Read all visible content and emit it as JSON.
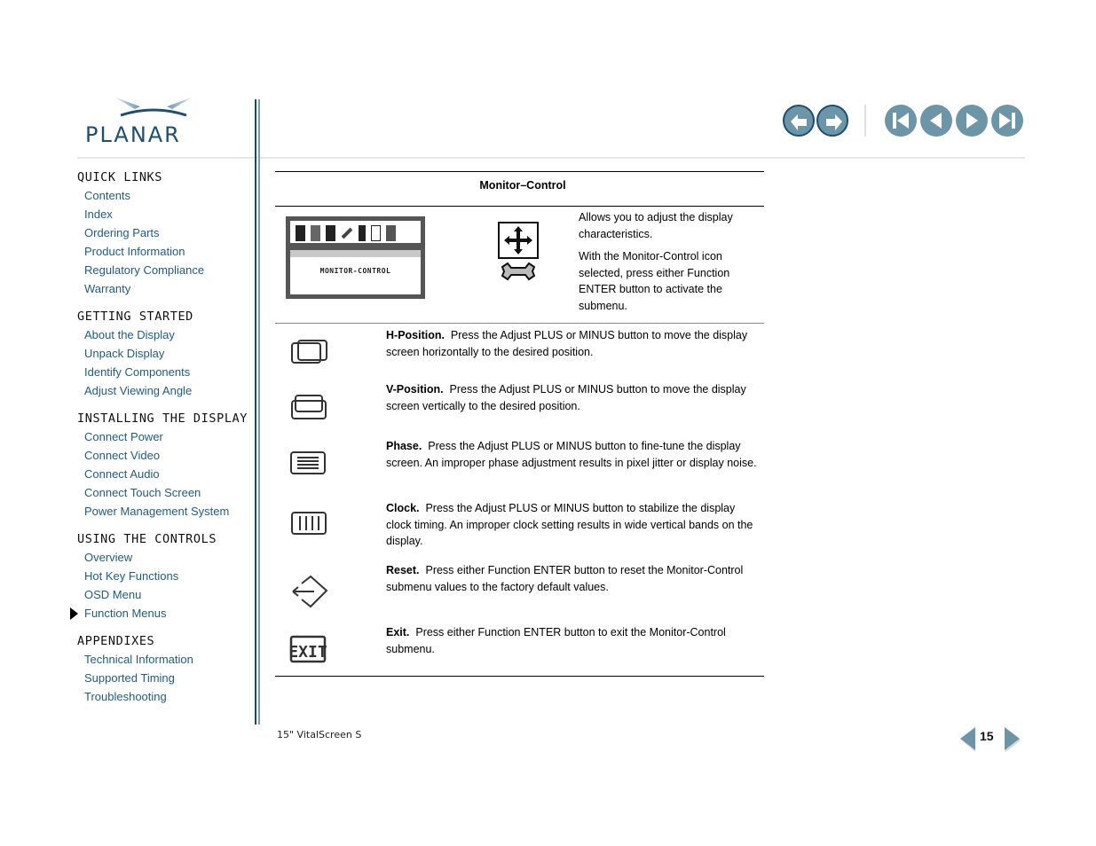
{
  "brand": {
    "name": "PLANAR",
    "color": "#1c4f72",
    "accent": "#6d95a8"
  },
  "top_nav": {
    "back_label": "back-icon",
    "forward_label": "forward-icon",
    "first_page": "first-page-icon",
    "prev_page": "previous-page-icon",
    "next_page": "next-page-icon",
    "last_page": "last-page-icon"
  },
  "sidebar": {
    "sections": [
      {
        "heading": "QUICK LINKS",
        "items": [
          "Contents",
          "Index",
          "Ordering Parts",
          "Product Information",
          "Regulatory Compliance",
          "Warranty"
        ]
      },
      {
        "heading": "GETTING STARTED",
        "items": [
          "About the Display",
          "Unpack Display",
          "Identify Components",
          "Adjust Viewing Angle"
        ]
      },
      {
        "heading": "INSTALLING THE DISPLAY",
        "items": [
          "Connect Power",
          "Connect Video",
          "Connect Audio",
          "Connect Touch Screen",
          "Power Management System"
        ]
      },
      {
        "heading": "USING THE CONTROLS",
        "items": [
          "Overview",
          "Hot Key Functions",
          "OSD Menu",
          "Function Menus"
        ]
      },
      {
        "heading": "APPENDIXES",
        "items": [
          "Technical Information",
          "Supported Timing",
          "Troubleshooting"
        ]
      }
    ],
    "current_item": "Function Menus"
  },
  "main": {
    "table_title": "Monitor–Control",
    "osd_label": "MONITOR-CONTROL",
    "intro": {
      "p1": "Allows you to adjust the display characteristics.",
      "p2": "With the Monitor-Control icon selected, press either Function ENTER button to activate the submenu."
    },
    "items": [
      {
        "title": "H-Position.",
        "text": "Press the Adjust PLUS or MINUS button to move the display screen horizontally to the desired position.",
        "icon": "h-position-icon"
      },
      {
        "title": "V-Position.",
        "text": "Press the Adjust PLUS or MINUS button to move the display screen vertically to the desired position.",
        "icon": "v-position-icon"
      },
      {
        "title": "Phase.",
        "text": "Press the Adjust PLUS or MINUS button to fine-tune the display screen. An improper phase adjustment results in pixel jitter or display noise.",
        "icon": "phase-icon"
      },
      {
        "title": "Clock.",
        "text": "Press the Adjust PLUS or MINUS button to stabilize the display clock timing. An improper clock setting results in wide vertical bands on the display.",
        "icon": "clock-icon"
      },
      {
        "title": "Reset.",
        "text": "Press either Function ENTER button to reset the Monitor-Control submenu values to the factory default values.",
        "icon": "reset-icon"
      },
      {
        "title": "Exit.",
        "text": "Press either Function ENTER button to exit the Monitor-Control submenu.",
        "icon": "exit-icon"
      }
    ]
  },
  "footer": {
    "product": "15\" VitalScreen S",
    "page_number": "15"
  }
}
